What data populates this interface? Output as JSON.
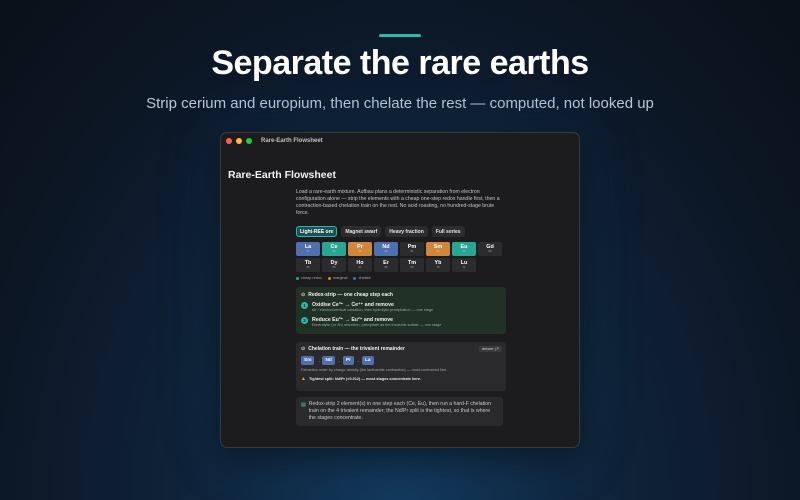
{
  "hero": {
    "title": "Separate the rare earths",
    "subtitle": "Strip cerium and europium, then chelate the rest — computed, not looked up"
  },
  "window": {
    "title": "Rare-Earth Flowsheet"
  },
  "app": {
    "title": "Rare-Earth Flowsheet",
    "description": "Load a rare-earth mixture. Aufbau plans a deterministic separation from electron configuration alone — strip the elements with a cheap one-step redox handle first, then a contraction-based chelation train on the rest. No acid roasting, no hundred-stage brute force."
  },
  "presets": [
    {
      "label": "Light-REE ore",
      "active": true
    },
    {
      "label": "Magnet swarf",
      "active": false
    },
    {
      "label": "Heavy fraction",
      "active": false
    },
    {
      "label": "Full series",
      "active": false
    }
  ],
  "elements": [
    {
      "symbol": "La",
      "number": "57",
      "status": "chelate"
    },
    {
      "symbol": "Ce",
      "number": "58",
      "status": "cheap"
    },
    {
      "symbol": "Pr",
      "number": "59",
      "status": "marginal"
    },
    {
      "symbol": "Nd",
      "number": "60",
      "status": "chelate"
    },
    {
      "symbol": "Pm",
      "number": "61",
      "status": "none"
    },
    {
      "symbol": "Sm",
      "number": "62",
      "status": "marginal"
    },
    {
      "symbol": "Eu",
      "number": "63",
      "status": "cheap"
    },
    {
      "symbol": "Gd",
      "number": "64",
      "status": "none"
    },
    {
      "symbol": "Tb",
      "number": "65",
      "status": "none"
    },
    {
      "symbol": "Dy",
      "number": "66",
      "status": "none"
    },
    {
      "symbol": "Ho",
      "number": "67",
      "status": "none"
    },
    {
      "symbol": "Er",
      "number": "68",
      "status": "none"
    },
    {
      "symbol": "Tm",
      "number": "69",
      "status": "none"
    },
    {
      "symbol": "Yb",
      "number": "70",
      "status": "none"
    },
    {
      "symbol": "Lu",
      "number": "71",
      "status": "none"
    }
  ],
  "legend": [
    {
      "label": "cheap redox",
      "color": "#2aa594"
    },
    {
      "label": "marginal",
      "color": "#d0873c"
    },
    {
      "label": "chelate",
      "color": "#4f6fae"
    }
  ],
  "redox": {
    "heading": "Redox-strip — one cheap step each",
    "steps": [
      {
        "num": "1",
        "title": "Oxidise Ce³⁺ → Ce⁴⁺ and remove",
        "desc": "Air / electrochemical oxidation, then hydrolytic precipitation — one stage"
      },
      {
        "num": "2",
        "title": "Reduce Eu³⁺ → Eu²⁺ and remove",
        "desc": "Electrolytic (or Zn) reduction, precipitate as the insoluble sulfate — one stage"
      }
    ]
  },
  "chelation": {
    "heading": "Chelation train — the trivalent remainder",
    "toggle": "denser | F",
    "order": [
      "Sm",
      "Nd",
      "Pr",
      "La"
    ],
    "note": "Extraction order by charge density (the lanthanide contraction) — most-contracted first.",
    "split": "Tightest split: Nd/Pr (<0.012) — most stages concentrate here."
  },
  "summary": {
    "text": "Redox-strip 2 element(s) in one step each (Ce, Eu), then run a hard-F chelation train on the 4 trivalent remainder; the Nd/Pr split is the tightest, so that is where the stages concentrate."
  }
}
